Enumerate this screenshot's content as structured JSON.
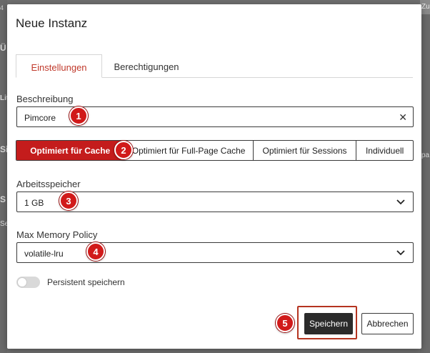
{
  "background": {
    "top_right_fragment": "Zu",
    "left_fragments": [
      "4",
      "Ü",
      "Lit",
      "Si",
      "S",
      "Se"
    ],
    "right_fragment": "pa"
  },
  "modal": {
    "title": "Neue Instanz",
    "tabs": [
      {
        "label": "Einstellungen",
        "active": true
      },
      {
        "label": "Berechtigungen",
        "active": false
      }
    ],
    "description": {
      "label": "Beschreibung",
      "value": "Pimcore"
    },
    "cache_modes": [
      {
        "label": "Optimiert für Cache",
        "active": true
      },
      {
        "label": "Optimiert für Full-Page Cache",
        "active": false
      },
      {
        "label": "Optimiert für Sessions",
        "active": false
      },
      {
        "label": "Individuell",
        "active": false
      }
    ],
    "memory": {
      "label": "Arbeitsspeicher",
      "value": "1 GB"
    },
    "memory_policy": {
      "label": "Max Memory Policy",
      "value": "volatile-lru"
    },
    "persistent": {
      "label": "Persistent speichern",
      "checked": false
    },
    "buttons": {
      "save": "Speichern",
      "cancel": "Abbrechen"
    }
  },
  "markers": [
    "1",
    "2",
    "3",
    "4",
    "5"
  ],
  "colors": {
    "accent": "#c41c1c",
    "marker": "#d11a1a",
    "primary_button": "#2b2b2b"
  }
}
